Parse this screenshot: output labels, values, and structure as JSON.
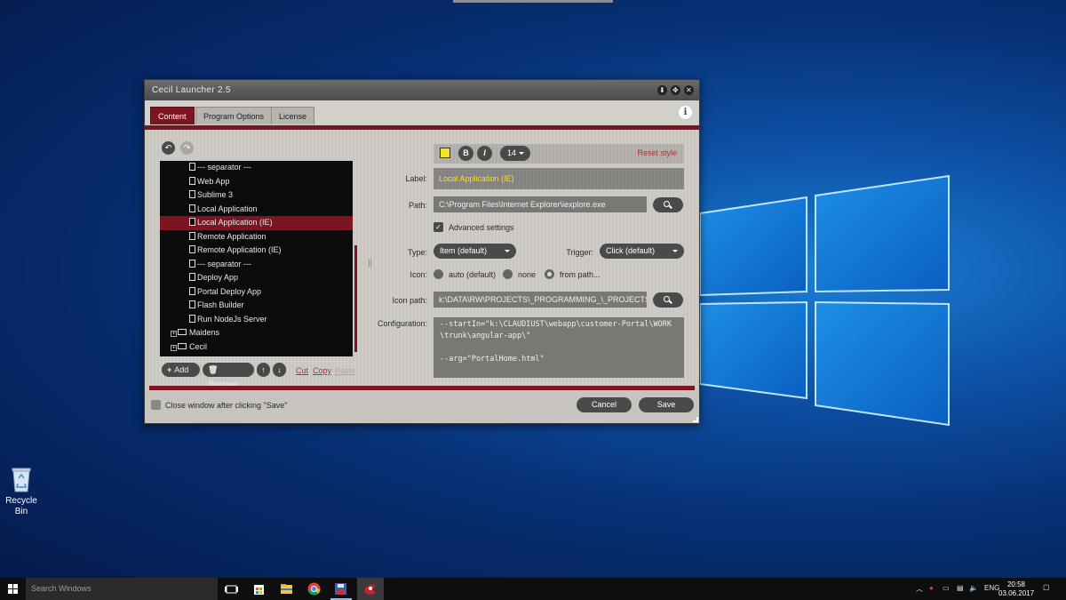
{
  "window": {
    "title": "Cecil Launcher 2.5",
    "tabs": [
      "Content",
      "Program Options",
      "License"
    ]
  },
  "tree": {
    "items": [
      {
        "label": "--- separator ---",
        "kind": "doc"
      },
      {
        "label": "Web App",
        "kind": "doc"
      },
      {
        "label": "Sublime 3",
        "kind": "doc"
      },
      {
        "label": "Local Application",
        "kind": "doc"
      },
      {
        "label": "Local Application (IE)",
        "kind": "doc",
        "selected": true
      },
      {
        "label": "Remote Application",
        "kind": "doc"
      },
      {
        "label": "Remote Application (IE)",
        "kind": "doc"
      },
      {
        "label": "--- separator ---",
        "kind": "doc"
      },
      {
        "label": "Deploy App",
        "kind": "doc"
      },
      {
        "label": "Portal Deploy App",
        "kind": "doc"
      },
      {
        "label": "Flash Builder",
        "kind": "doc"
      },
      {
        "label": "Run NodeJs Server",
        "kind": "doc"
      },
      {
        "label": "Maidens",
        "kind": "folder"
      },
      {
        "label": "Cecil",
        "kind": "folder"
      }
    ]
  },
  "tree_actions": {
    "add": "Add",
    "remove": "Remove",
    "cut": "Cut",
    "copy": "Copy",
    "paste": "Paste"
  },
  "style_bar": {
    "bold": "B",
    "italic": "I",
    "font_size": "14",
    "reset": "Reset style"
  },
  "form": {
    "label_caption": "Label:",
    "label_value": "Local Application (IE)",
    "path_caption": "Path:",
    "path_value": "C:\\Program Files\\Internet Explorer\\iexplore.exe",
    "advanced_label": "Advanced settings",
    "type_caption": "Type:",
    "type_value": "Item (default)",
    "trigger_caption": "Trigger:",
    "trigger_value": "Click (default)",
    "icon_caption": "Icon:",
    "icon_options": [
      "auto (default)",
      "none",
      "from path..."
    ],
    "icon_path_caption": "Icon path:",
    "icon_path_value": "k:\\DATA\\RW\\PROJECTS\\_PROGRAMMING_\\_PROJECTS",
    "config_caption": "Configuration:",
    "config_value": "--startIn=\"k:\\CLAUDIUST\\webapp\\customer-Portal\\WORK\\trunk\\angular-app\\\"\n\n--arg=\"PortalHome.html\""
  },
  "footer": {
    "close_after_save": "Close window after clicking \"Save\"",
    "cancel": "Cancel",
    "save": "Save"
  },
  "desktop": {
    "recycle_bin": "Recycle Bin"
  },
  "taskbar": {
    "search_placeholder": "Search Windows",
    "language": "ENG",
    "time": "20:58",
    "date": "03.06.2017"
  },
  "colors": {
    "accent": "#7b1620",
    "label_text": "#f1e227",
    "reset_link": "#a3363f"
  }
}
